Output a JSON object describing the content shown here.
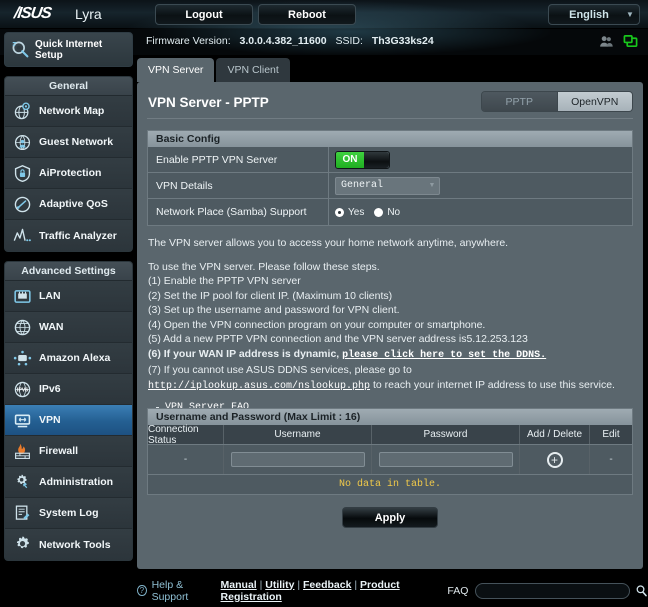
{
  "topbar": {
    "logo": "/ISUS",
    "brand": "Lyra",
    "logout_label": "Logout",
    "reboot_label": "Reboot",
    "language": "English"
  },
  "infobar": {
    "firmware_label": "Firmware Version:",
    "firmware_value": "3.0.0.4.382_11600",
    "ssid_label": "SSID:",
    "ssid_value": "Th3G33ks24",
    "icons": [
      "clients-icon",
      "usb-device-icon"
    ]
  },
  "sidebar": {
    "quick_setup": "Quick Internet Setup",
    "groups": [
      {
        "title": "General",
        "items": [
          {
            "label": "Network Map",
            "icon": "network-map-icon",
            "active": false
          },
          {
            "label": "Guest Network",
            "icon": "guest-network-icon",
            "active": false
          },
          {
            "label": "AiProtection",
            "icon": "shield-icon",
            "active": false
          },
          {
            "label": "Adaptive QoS",
            "icon": "gauge-icon",
            "active": false
          },
          {
            "label": "Traffic Analyzer",
            "icon": "traffic-analyzer-icon",
            "active": false
          }
        ]
      },
      {
        "title": "Advanced Settings",
        "items": [
          {
            "label": "LAN",
            "icon": "lan-icon",
            "active": false
          },
          {
            "label": "WAN",
            "icon": "globe-icon",
            "active": false
          },
          {
            "label": "Amazon Alexa",
            "icon": "alexa-icon",
            "active": false
          },
          {
            "label": "IPv6",
            "icon": "ipv6-icon",
            "active": false
          },
          {
            "label": "VPN",
            "icon": "vpn-icon",
            "active": true
          },
          {
            "label": "Firewall",
            "icon": "firewall-icon",
            "active": false
          },
          {
            "label": "Administration",
            "icon": "gear-icon",
            "active": false
          },
          {
            "label": "System Log",
            "icon": "system-log-icon",
            "active": false
          },
          {
            "label": "Network Tools",
            "icon": "network-tools-icon",
            "active": false
          }
        ]
      }
    ]
  },
  "tabs": [
    {
      "label": "VPN Server",
      "active": true
    },
    {
      "label": "VPN Client",
      "active": false
    }
  ],
  "panel": {
    "title": "VPN Server - PPTP",
    "segments": [
      {
        "label": "PPTP",
        "selected": true
      },
      {
        "label": "OpenVPN",
        "selected": false
      }
    ]
  },
  "basic_config": {
    "header": "Basic Config",
    "rows": [
      {
        "label": "Enable PPTP VPN Server",
        "control": "toggle",
        "value": "ON"
      },
      {
        "label": "VPN Details",
        "control": "select",
        "value": "General"
      },
      {
        "label": "Network Place (Samba) Support",
        "control": "radio",
        "options": [
          {
            "label": "Yes",
            "selected": true
          },
          {
            "label": "No",
            "selected": false
          }
        ]
      }
    ]
  },
  "instructions": {
    "intro": "The VPN server allows you to access your home network anytime, anywhere.",
    "lead": "To use the VPN server. Please follow these steps.",
    "steps": [
      "(1) Enable the PPTP VPN server",
      "(2) Set the IP pool for client IP. (Maximum 10 clients)",
      "(3) Set up the username and password for VPN client.",
      "(4) Open the VPN connection program on your computer or smartphone.",
      "(5) Add a new PPTP VPN connection and the VPN server address is5.12.253.123"
    ],
    "step6_prefix": "(6) If your WAN IP address is dynamic, ",
    "step6_link": "please click here to set the DDNS.",
    "step7_prefix": "(7) If you cannot use ASUS DDNS services, please go to ",
    "step7_link": "http://iplookup.asus.com/nslookup.php",
    "step7_suffix": " to reach your internet IP address to use this service.",
    "faq_link": "VPN Server FAQ"
  },
  "user_table": {
    "header": "Username and Password (Max Limit : 16)",
    "columns": [
      "Connection Status",
      "Username",
      "Password",
      "Add / Delete",
      "Edit"
    ],
    "row": {
      "connection_status": "-",
      "username_value": "",
      "password_value": "",
      "add_icon": "plus-circle-icon",
      "edit": "-"
    },
    "empty_message": "No data in table."
  },
  "apply_label": "Apply",
  "footer": {
    "help_label": "Help & Support",
    "links": [
      "Manual",
      "Utility",
      "Feedback",
      "Product Registration"
    ],
    "faq_label": "FAQ",
    "faq_placeholder": "",
    "search_icon": "search-icon"
  }
}
